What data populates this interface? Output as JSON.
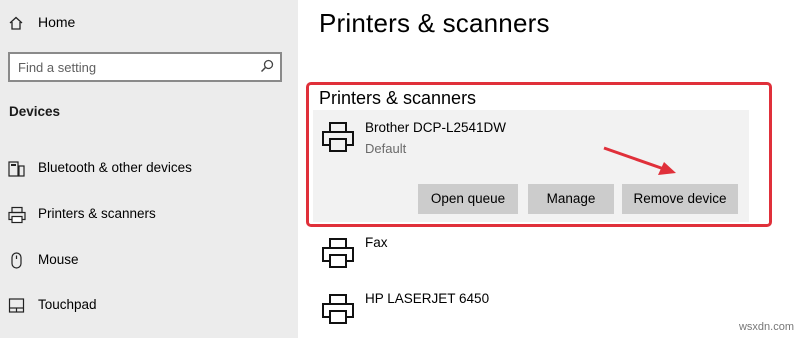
{
  "sidebar": {
    "home_label": "Home",
    "search_placeholder": "Find a setting",
    "section_title": "Devices",
    "items": [
      {
        "label": "Bluetooth & other devices",
        "icon": "bluetooth-devices-icon"
      },
      {
        "label": "Printers & scanners",
        "icon": "printer-icon"
      },
      {
        "label": "Mouse",
        "icon": "mouse-icon"
      },
      {
        "label": "Touchpad",
        "icon": "touchpad-icon"
      }
    ]
  },
  "main": {
    "title": "Printers & scanners",
    "subtitle": "Printers & scanners",
    "selected_device": {
      "name": "Brother DCP-L2541DW",
      "status": "Default",
      "buttons": {
        "open_queue": "Open queue",
        "manage": "Manage",
        "remove": "Remove device"
      }
    },
    "devices": [
      {
        "name": "Fax"
      },
      {
        "name": "HP LASERJET 6450"
      }
    ]
  },
  "annotation": {
    "highlight_color": "#e0303a",
    "arrow_color": "#e0303a"
  },
  "watermark": "wsxdn.com"
}
